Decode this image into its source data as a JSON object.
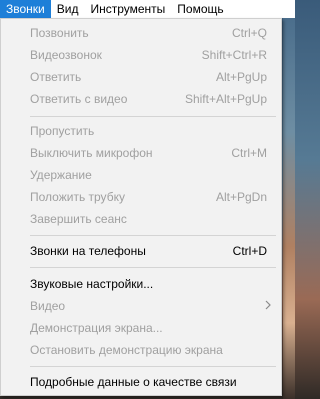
{
  "menubar": {
    "items": [
      {
        "label": "Звонки"
      },
      {
        "label": "Вид"
      },
      {
        "label": "Инструменты"
      },
      {
        "label": "Помощь"
      }
    ]
  },
  "menu": {
    "items": [
      {
        "label": "Позвонить",
        "shortcut": "Ctrl+Q"
      },
      {
        "label": "Видеозвонок",
        "shortcut": "Shift+Ctrl+R"
      },
      {
        "label": "Ответить",
        "shortcut": "Alt+PgUp"
      },
      {
        "label": "Ответить с видео",
        "shortcut": "Shift+Alt+PgUp"
      },
      {
        "label": "Пропустить",
        "shortcut": ""
      },
      {
        "label": "Выключить микрофон",
        "shortcut": "Ctrl+M"
      },
      {
        "label": "Удержание",
        "shortcut": ""
      },
      {
        "label": "Положить трубку",
        "shortcut": "Alt+PgDn"
      },
      {
        "label": "Завершить сеанс",
        "shortcut": ""
      },
      {
        "label": "Звонки на телефоны",
        "shortcut": "Ctrl+D"
      },
      {
        "label": "Звуковые настройки...",
        "shortcut": ""
      },
      {
        "label": "Видео",
        "shortcut": ""
      },
      {
        "label": "Демонстрация экрана...",
        "shortcut": ""
      },
      {
        "label": "Остановить демонстрацию экрана",
        "shortcut": ""
      },
      {
        "label": "Подробные данные о качестве связи",
        "shortcut": ""
      }
    ]
  }
}
